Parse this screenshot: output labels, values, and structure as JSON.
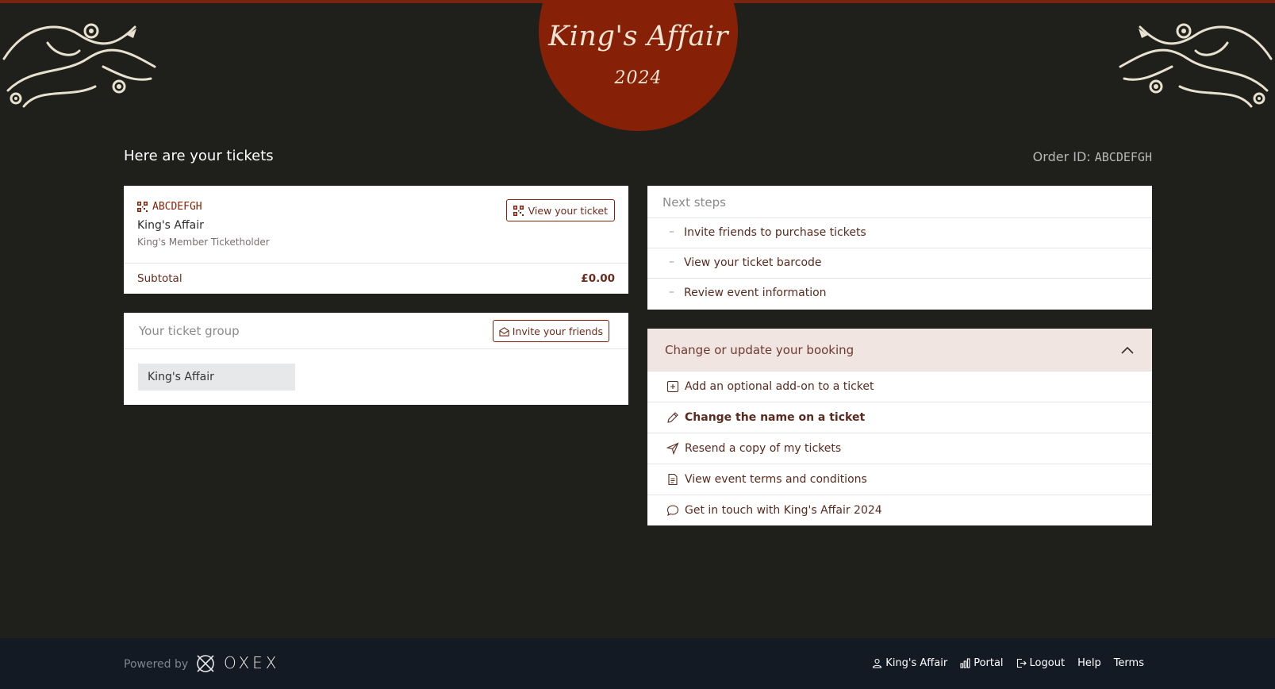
{
  "brand": {
    "logo_title": "King's Affair",
    "logo_year": "2024",
    "colors": {
      "primary": "#862107",
      "background": "#1f201c",
      "footer": "#141a24"
    }
  },
  "header": {
    "heading": "Here are your tickets",
    "order_id_label": "Order ID:",
    "order_id_value": "ABCDEFGH"
  },
  "ticket": {
    "code": "ABCDEFGH",
    "event": "King's Affair",
    "type": "King's Member Ticketholder",
    "view_button": "View your ticket",
    "subtotal_label": "Subtotal",
    "subtotal_value": "£0.00"
  },
  "group": {
    "title": "Your ticket group",
    "invite_button": "Invite your friends",
    "chip": "King's Affair"
  },
  "next_steps": {
    "title": "Next steps",
    "items": [
      "Invite friends to purchase tickets",
      "View your ticket barcode",
      "Review event information"
    ]
  },
  "change": {
    "title": "Change or update your booking",
    "items": [
      {
        "label": "Add an optional add-on to a ticket",
        "icon": "plus-square-icon"
      },
      {
        "label": "Change the name on a ticket",
        "icon": "pencil-icon"
      },
      {
        "label": "Resend a copy of my tickets",
        "icon": "send-icon"
      },
      {
        "label": "View event terms and conditions",
        "icon": "document-icon"
      },
      {
        "label": "Get in touch with King's Affair 2024",
        "icon": "chat-icon"
      }
    ]
  },
  "footer": {
    "powered_by": "Powered by",
    "provider": "OXEX",
    "links": [
      {
        "label": "King's Affair",
        "icon": "user-icon"
      },
      {
        "label": "Portal",
        "icon": "bar-chart-icon"
      },
      {
        "label": "Logout",
        "icon": "logout-icon"
      },
      {
        "label": "Help",
        "icon": ""
      },
      {
        "label": "Terms",
        "icon": ""
      }
    ]
  }
}
